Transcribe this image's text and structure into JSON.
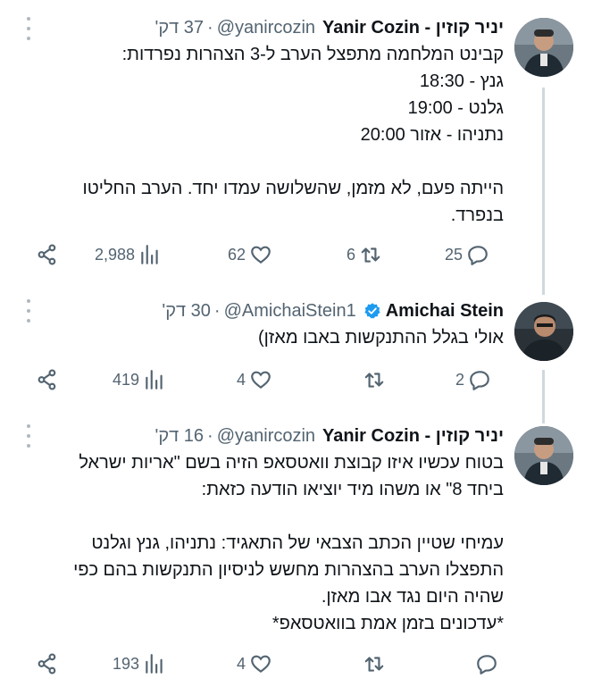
{
  "tweets": [
    {
      "name": "יניר קוזין - Yanir Cozin",
      "handle": "@yanircozin",
      "time": "37 דק'",
      "verified": false,
      "text": "קבינט המלחמה מתפצל הערב ל-3 הצהרות נפרדות:\nגנץ - 18:30\nגלנט - 19:00\nנתניהו - אזור 20:00\n\nהייתה פעם, לא מזמן, שהשלושה עמדו יחד. הערב החליטו בנפרד.",
      "replies": "25",
      "retweets": "6",
      "likes": "62",
      "views": "2,988"
    },
    {
      "name": "Amichai Stein",
      "handle": "@AmichaiStein1",
      "time": "30 דק'",
      "verified": true,
      "text": "אולי בגלל ההתנקשות באבו מאזן)",
      "replies": "2",
      "retweets": "",
      "likes": "4",
      "views": "419"
    },
    {
      "name": "יניר קוזין - Yanir Cozin",
      "handle": "@yanircozin",
      "time": "16 דק'",
      "verified": false,
      "text": "בטוח עכשיו איזו קבוצת וואטסאפ הזיה בשם \"אריות ישראל ביחד 8\" או משהו מיד יוציאו הודעה כזאת:\n\nעמיחי שטיין הכתב הצבאי של התאגיד: נתניהו, גנץ וגלנט התפצלו הערב בהצהרות מחשש לניסיון התנקשות בהם כפי שהיה היום נגד אבו מאזן.\n*עדכונים בזמן אמת בוואטסאפ*",
      "replies": "",
      "retweets": "",
      "likes": "4",
      "views": "193"
    }
  ],
  "colors": {
    "text": "#0f1419",
    "muted": "#536471",
    "verified": "#1d9bf0",
    "thread_line": "#cfd9de"
  },
  "icons": {
    "reply": "reply-icon",
    "retweet": "retweet-icon",
    "like": "like-icon",
    "views": "views-icon",
    "share": "share-icon",
    "more": "more-icon",
    "verified": "verified-badge-icon"
  }
}
